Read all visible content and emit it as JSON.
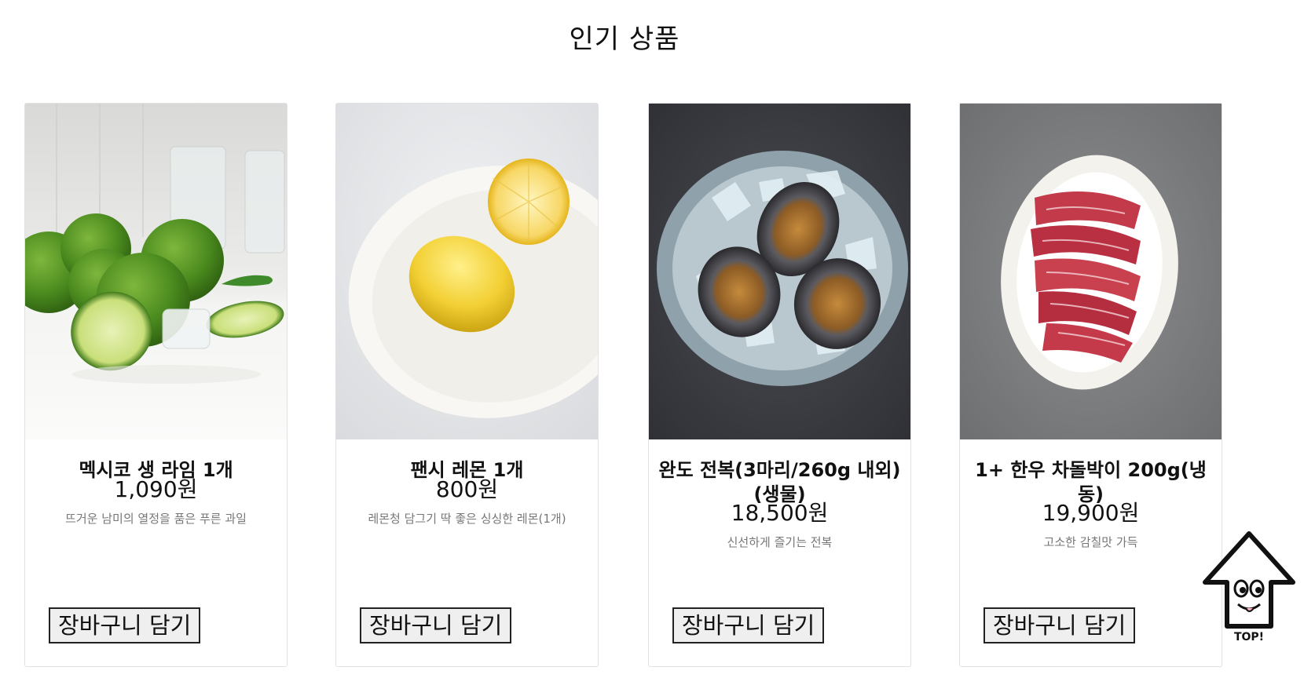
{
  "section": {
    "title": "인기 상품"
  },
  "products": [
    {
      "name": "멕시코 생 라임 1개",
      "price": "1,090원",
      "desc": "뜨거운 남미의 열정을 품은 푸른 과일",
      "button": "장바구니 담기"
    },
    {
      "name": "팬시 레몬 1개",
      "price": "800원",
      "desc": "레몬청 담그기 딱 좋은 싱싱한 레몬(1개)",
      "button": "장바구니 담기"
    },
    {
      "name": "완도 전복(3마리/260g 내외)(생물)",
      "price": "18,500원",
      "desc": "신선하게 즐기는 전복",
      "button": "장바구니 담기"
    },
    {
      "name": "1+ 한우 차돌박이 200g(냉동)",
      "price": "19,900원",
      "desc": "고소한 감칠맛 가득",
      "button": "장바구니 담기"
    }
  ],
  "top_button": {
    "label": "TOP!"
  },
  "icons": {
    "top": "arrow-up-face-icon"
  }
}
